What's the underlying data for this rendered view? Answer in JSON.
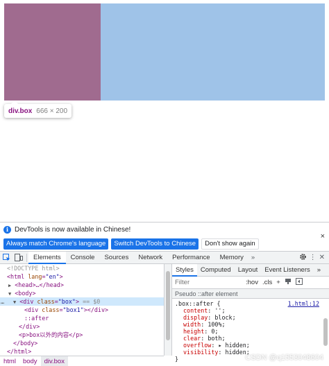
{
  "page": {
    "box1_color": "#a06b8f",
    "box_color": "#9fc3e8",
    "tooltip": {
      "tag": "div.box",
      "dims": "666 × 200"
    }
  },
  "devtools": {
    "infobar": {
      "text": "DevTools is now available in Chinese!",
      "btn_match": "Always match Chrome's language",
      "btn_switch": "Switch DevTools to Chinese",
      "btn_dont": "Don't show again",
      "close": "×"
    },
    "tabs": [
      "Elements",
      "Console",
      "Sources",
      "Network",
      "Performance",
      "Memory"
    ],
    "tabs_more": "»",
    "elements": {
      "doctype": "<!DOCTYPE html>",
      "html_open_tag": "<html",
      "html_attr_name": "lang",
      "html_attr_value": "\"en\"",
      "head": "<head>…</head>",
      "body_open": "<body>",
      "div_box_tag": "<div",
      "div_box_attr_name": "class",
      "div_box_attr_value": "\"box\"",
      "div_box_suffix": "== $0",
      "div_box1_tag": "<div",
      "div_box1_attr_name": "class",
      "div_box1_attr_value": "\"box1\"",
      "div_box1_close": "></div>",
      "after_pseudo": "::after",
      "div_close": "</div>",
      "p_line": "<p>box以外的内容</p>",
      "body_close": "</body>",
      "html_close": "</html>",
      "dots": "…"
    },
    "breadcrumbs": [
      "html",
      "body",
      "div.box"
    ],
    "styles": {
      "tabs": [
        "Styles",
        "Computed",
        "Layout",
        "Event Listeners"
      ],
      "tabs_more": "»",
      "filter_placeholder": "Filter",
      "hov": ":hov",
      "cls": ".cls",
      "plus": "+",
      "pseudo_header": "Pseudo ::after element",
      "rule_selector": ".box::after {",
      "rule_source": "1.html:12",
      "props": [
        {
          "name": "content",
          "value": "'';"
        },
        {
          "name": "display",
          "value": "block;"
        },
        {
          "name": "width",
          "value": "100%;"
        },
        {
          "name": "height",
          "value": "0;"
        },
        {
          "name": "clear",
          "value": "both;"
        },
        {
          "name": "overflow",
          "value": "▸ hidden;"
        },
        {
          "name": "visibility",
          "value": "hidden;"
        }
      ],
      "rule_close": "}"
    }
  },
  "watermark": "CSDN @q1553048604"
}
